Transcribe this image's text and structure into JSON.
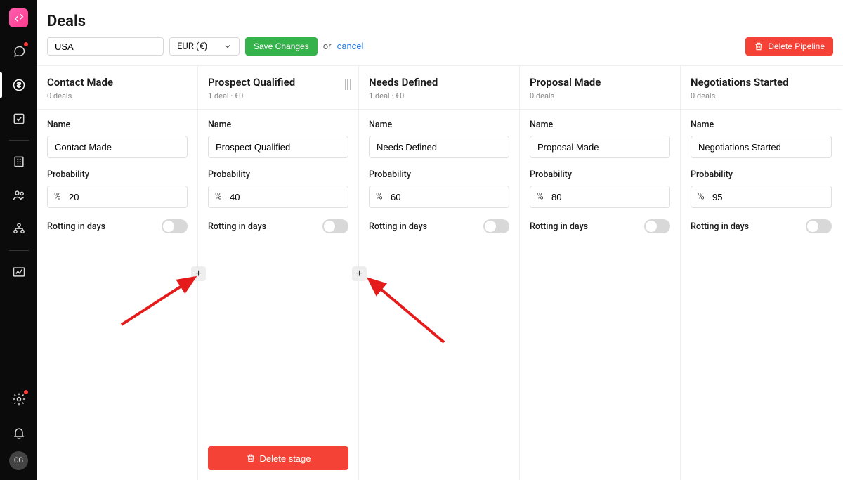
{
  "page": {
    "title": "Deals"
  },
  "toolbar": {
    "name_value": "USA",
    "currency": "EUR (€)",
    "save_label": "Save Changes",
    "or_label": "or",
    "cancel_label": "cancel",
    "delete_pipeline_label": "Delete Pipeline"
  },
  "avatar_initials": "CG",
  "columns": [
    {
      "title": "Contact Made",
      "sub": "0 deals",
      "name": "Contact Made",
      "probability": "20",
      "rotting_label": "Rotting in days",
      "active": false
    },
    {
      "title": "Prospect Qualified",
      "sub": "1 deal · €0",
      "name": "Prospect Qualified",
      "probability": "40",
      "rotting_label": "Rotting in days",
      "active": true,
      "show_drag": true,
      "delete_stage_label": "Delete stage"
    },
    {
      "title": "Needs Defined",
      "sub": "1 deal · €0",
      "name": "Needs Defined",
      "probability": "60",
      "rotting_label": "Rotting in days",
      "active": false
    },
    {
      "title": "Proposal Made",
      "sub": "0 deals",
      "name": "Proposal Made",
      "probability": "80",
      "rotting_label": "Rotting in days",
      "active": false
    },
    {
      "title": "Negotiations Started",
      "sub": "0 deals",
      "name": "Negotiations Started",
      "probability": "95",
      "rotting_label": "Rotting in days",
      "active": false
    }
  ],
  "labels": {
    "name": "Name",
    "probability": "Probability",
    "percent": "%"
  }
}
